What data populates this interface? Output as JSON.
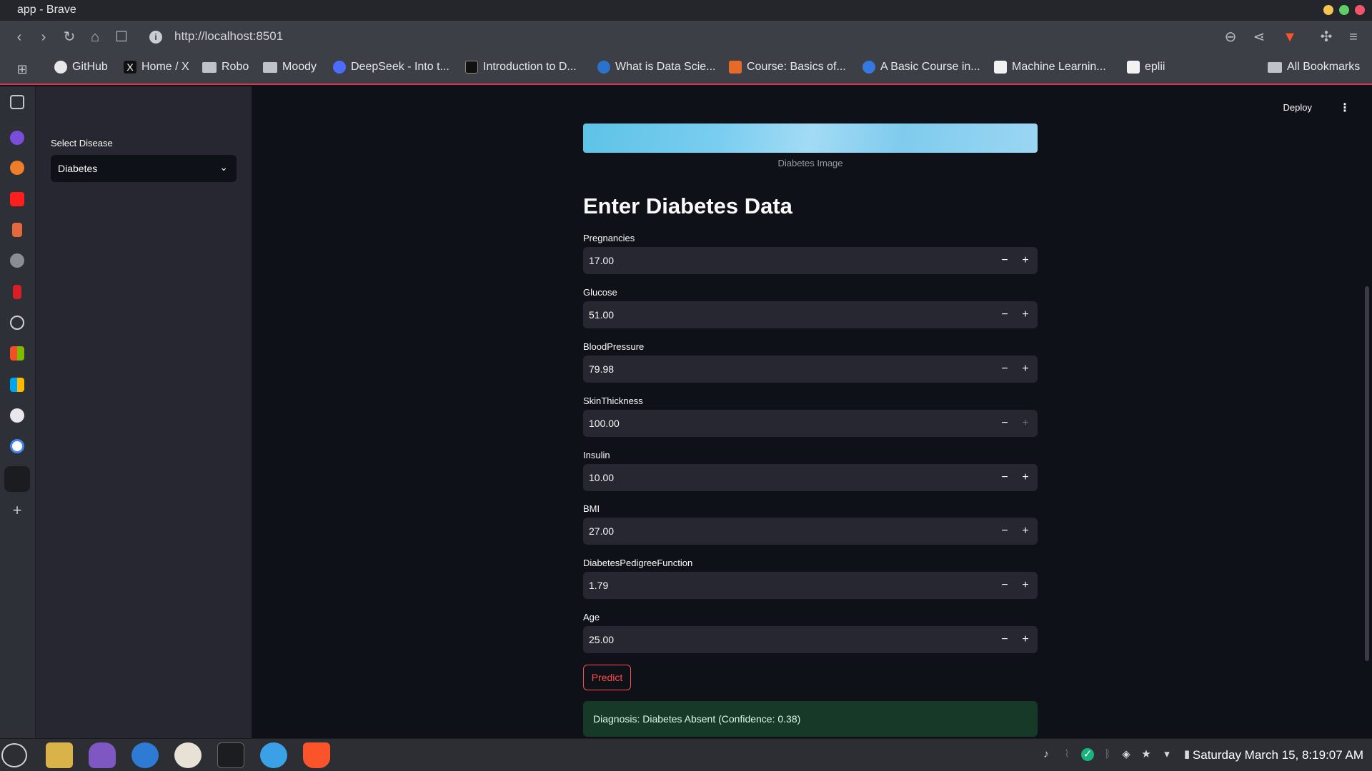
{
  "window": {
    "title": "app - Brave"
  },
  "browser": {
    "url": "http://localhost:8501",
    "bookmarks": [
      {
        "label": "GitHub",
        "icon": "github-icon"
      },
      {
        "label": "Home / X",
        "icon": "x-icon"
      },
      {
        "label": "Robo",
        "icon": "folder-icon"
      },
      {
        "label": "Moody",
        "icon": "folder-icon"
      },
      {
        "label": "DeepSeek - Into t...",
        "icon": "deepseek-icon"
      },
      {
        "label": "Introduction to D...",
        "icon": "site-icon"
      },
      {
        "label": "What is Data Scie...",
        "icon": "coursera-icon"
      },
      {
        "label": "Course: Basics of...",
        "icon": "site-icon"
      },
      {
        "label": "A Basic Course in...",
        "icon": "site-icon"
      },
      {
        "label": "Machine Learnin...",
        "icon": "chart-icon"
      },
      {
        "label": "eplii",
        "icon": "site-icon"
      }
    ],
    "all_bookmarks": "All Bookmarks"
  },
  "sidebar": {
    "select_label": "Select Disease",
    "selected": "Diabetes"
  },
  "header": {
    "deploy": "Deploy",
    "menu_icon": "kebab-menu-icon"
  },
  "main": {
    "image_caption": "Diabetes Image",
    "title": "Enter Diabetes Data",
    "fields": [
      {
        "label": "Pregnancies",
        "value": "17.00"
      },
      {
        "label": "Glucose",
        "value": "51.00"
      },
      {
        "label": "BloodPressure",
        "value": "79.98"
      },
      {
        "label": "SkinThickness",
        "value": "100.00"
      },
      {
        "label": "Insulin",
        "value": "10.00"
      },
      {
        "label": "BMI",
        "value": "27.00"
      },
      {
        "label": "DiabetesPedigreeFunction",
        "value": "1.79"
      },
      {
        "label": "Age",
        "value": "25.00"
      }
    ],
    "minus_glyph": "−",
    "plus_glyph": "+",
    "predict_label": "Predict",
    "result": "Diagnosis: Diabetes Absent (Confidence: 0.38)"
  },
  "taskbar": {
    "clock": "Saturday March 15, 8:19:07 AM"
  },
  "colors": {
    "accent": "#ff4b4b",
    "success_bg": "#173928",
    "sidebar_bg": "#262730",
    "main_bg": "#0e1117"
  }
}
